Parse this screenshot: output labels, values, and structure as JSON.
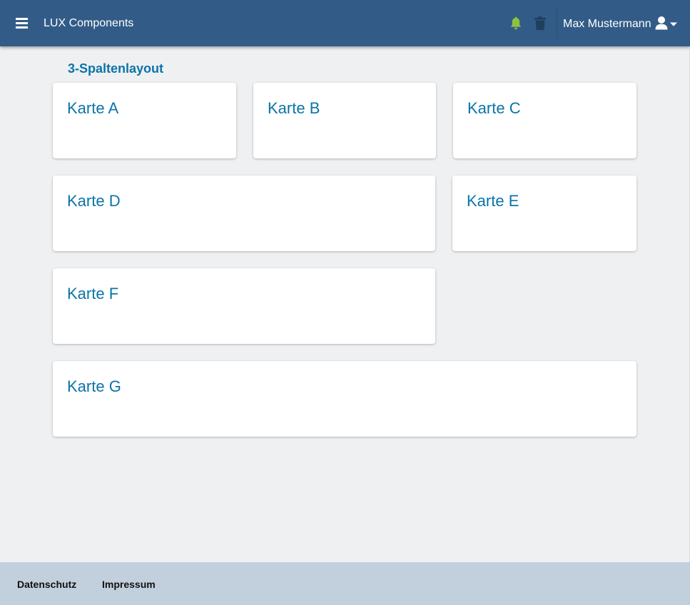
{
  "header": {
    "app_title": "LUX Components",
    "user_name": "Max Mustermann",
    "menu_icon": "hamburger-menu-icon",
    "notification_icon": "bell-icon",
    "trash_icon": "trash-icon",
    "user_icon": "user-icon",
    "colors": {
      "background": "#325c87",
      "bell": "#8fc23f",
      "trash": "#1f3f5e"
    }
  },
  "main": {
    "section_title": "3-Spaltenlayout",
    "cards": [
      {
        "title": "Karte A"
      },
      {
        "title": "Karte B"
      },
      {
        "title": "Karte C"
      },
      {
        "title": "Karte D"
      },
      {
        "title": "Karte E"
      },
      {
        "title": "Karte F"
      },
      {
        "title": "Karte G"
      }
    ],
    "colors": {
      "accent": "#0a74a9",
      "background": "#eff0f2"
    }
  },
  "footer": {
    "links": [
      {
        "label": "Datenschutz"
      },
      {
        "label": "Impressum"
      }
    ],
    "colors": {
      "background": "#c2cfdc"
    }
  }
}
